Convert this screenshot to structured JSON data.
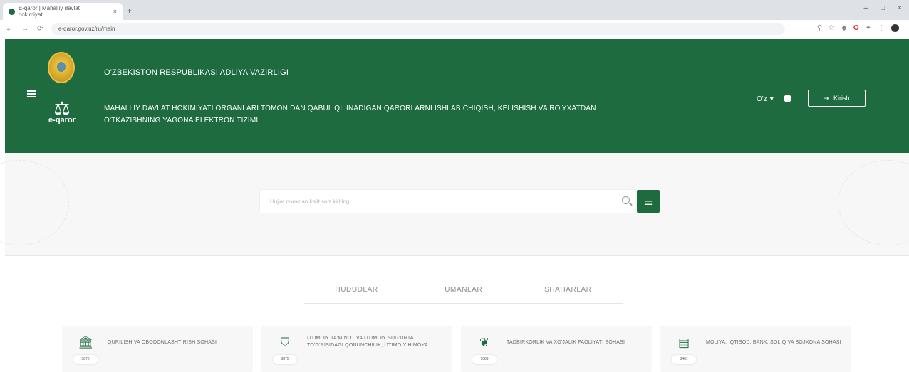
{
  "browser": {
    "tab_title": "E-qaror | Mahalliy davlat hokimiyati...",
    "url": "e-qaror.gov.uz/ru/main"
  },
  "header": {
    "ministry": "O'ZBEKISTON RESPUBLIKASI ADLIYA VAZIRLIGI",
    "system_title": "MAHALLIY DAVLAT HOKIMIYATI ORGANLARI TOMONIDAN QABUL QILINADIGAN QARORLARNI ISHLAB CHIQISH, KELISHISH VA RO'YXATDAN O'TKAZISHNING YAGONA ELEKTRON TIZIMI",
    "logo_text": "e-qaror",
    "language": "O'z",
    "login_label": "Kirish"
  },
  "search": {
    "placeholder": "Hujjat nomidan kalit so'z kiriting"
  },
  "tabs": [
    "HUDUDLAR",
    "TUMANLAR",
    "SHAHARLAR"
  ],
  "cards": [
    {
      "icon": "building-icon",
      "label": "QURILISH VA OBODONLASHTIRISH SOHASI",
      "count": "3870"
    },
    {
      "icon": "shield-icon",
      "label": "IJTIMOIY TA'MINOT VA IJTIMOIY SUG'URTA TO'G'RISIDAGI QONUNCHILIK, IJTIMOIY HIMOYA",
      "count": "3875"
    },
    {
      "icon": "handshake-icon",
      "label": "TADBIRKORLIK VA XO'JALIK FAOLIYATI SOHASI",
      "count": "7089"
    },
    {
      "icon": "finance-icon",
      "label": "MOLIYA, IQTISOD, BANK, SOLIQ VA BOJXONA SOHASI",
      "count": "3461"
    }
  ]
}
